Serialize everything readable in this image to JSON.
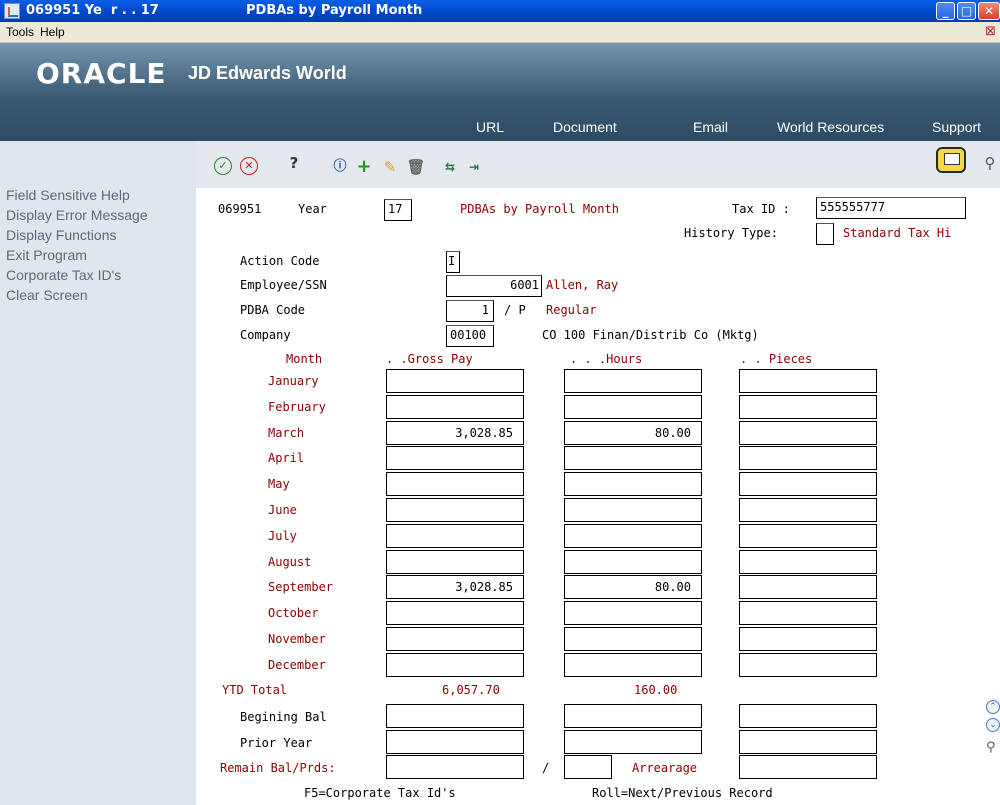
{
  "window": {
    "title_left": "069951 Ye  r . . 17",
    "title_right": "PDBAs by Payroll Month",
    "minimize_glyph": "_",
    "maximize_glyph": "□",
    "close_glyph": "✕"
  },
  "menu": {
    "items": [
      "Tools",
      "Help"
    ]
  },
  "banner": {
    "logo": "ORACLE",
    "product": "JD Edwards World",
    "nav": [
      "URL",
      "Document",
      "Email",
      "World Resources",
      "Support"
    ]
  },
  "sidebar": {
    "exits": [
      "Field Sensitive Help",
      "Display Error Message",
      "Display Functions",
      "Exit Program",
      "Corporate Tax ID's",
      "Clear Screen"
    ]
  },
  "toolbar": {
    "icons": [
      "ok-icon",
      "cancel-icon",
      "help-icon",
      "info-icon",
      "add-icon",
      "edit-icon",
      "delete-icon",
      "copy-icon",
      "export-icon",
      "messages-icon",
      "search-icon"
    ]
  },
  "form": {
    "company_code": "069951",
    "year_label": "Year",
    "year_value": "17",
    "screen_title": "PDBAs by Payroll Month",
    "tax_id_label": "Tax ID :",
    "tax_id_value": "555555777",
    "history_type_label": "History Type:",
    "history_type_value": "",
    "history_type_desc": "Standard Tax Hi",
    "action_code_label": "Action Code",
    "action_code_value": "I",
    "employee_label": "Employee/SSN",
    "employee_value": "6001",
    "employee_name": "Allen, Ray",
    "pdba_label": "PDBA Code",
    "pdba_value": "1",
    "pdba_sep": "/ P",
    "pdba_desc": "Regular",
    "company_label": "Company",
    "company_value": "00100",
    "company_desc": "CO 100 Finan/Distrib Co (Mktg)",
    "col_month": "Month",
    "col_gross": ". .Gross Pay",
    "col_hours": ". . .Hours",
    "col_pieces": ". . Pieces",
    "months": [
      {
        "name": "January",
        "gross": "",
        "hours": "",
        "pieces": ""
      },
      {
        "name": "February",
        "gross": "",
        "hours": "",
        "pieces": ""
      },
      {
        "name": "March",
        "gross": "3,028.85",
        "hours": "80.00",
        "pieces": ""
      },
      {
        "name": "April",
        "gross": "",
        "hours": "",
        "pieces": ""
      },
      {
        "name": "May",
        "gross": "",
        "hours": "",
        "pieces": ""
      },
      {
        "name": "June",
        "gross": "",
        "hours": "",
        "pieces": ""
      },
      {
        "name": "July",
        "gross": "",
        "hours": "",
        "pieces": ""
      },
      {
        "name": "August",
        "gross": "",
        "hours": "",
        "pieces": ""
      },
      {
        "name": "September",
        "gross": "3,028.85",
        "hours": "80.00",
        "pieces": ""
      },
      {
        "name": "October",
        "gross": "",
        "hours": "",
        "pieces": ""
      },
      {
        "name": "November",
        "gross": "",
        "hours": "",
        "pieces": ""
      },
      {
        "name": "December",
        "gross": "",
        "hours": "",
        "pieces": ""
      }
    ],
    "ytd_label": "YTD Total",
    "ytd_gross": "6,057.70",
    "ytd_hours": "160.00",
    "beg_bal_label": "Begining Bal",
    "prior_year_label": "Prior Year",
    "remain_label": "Remain Bal/Prds:",
    "remain_sep": "/",
    "arrearage_label": "Arrearage",
    "footer_left": "F5=Corporate Tax Id's",
    "footer_right": "Roll=Next/Previous Record"
  }
}
